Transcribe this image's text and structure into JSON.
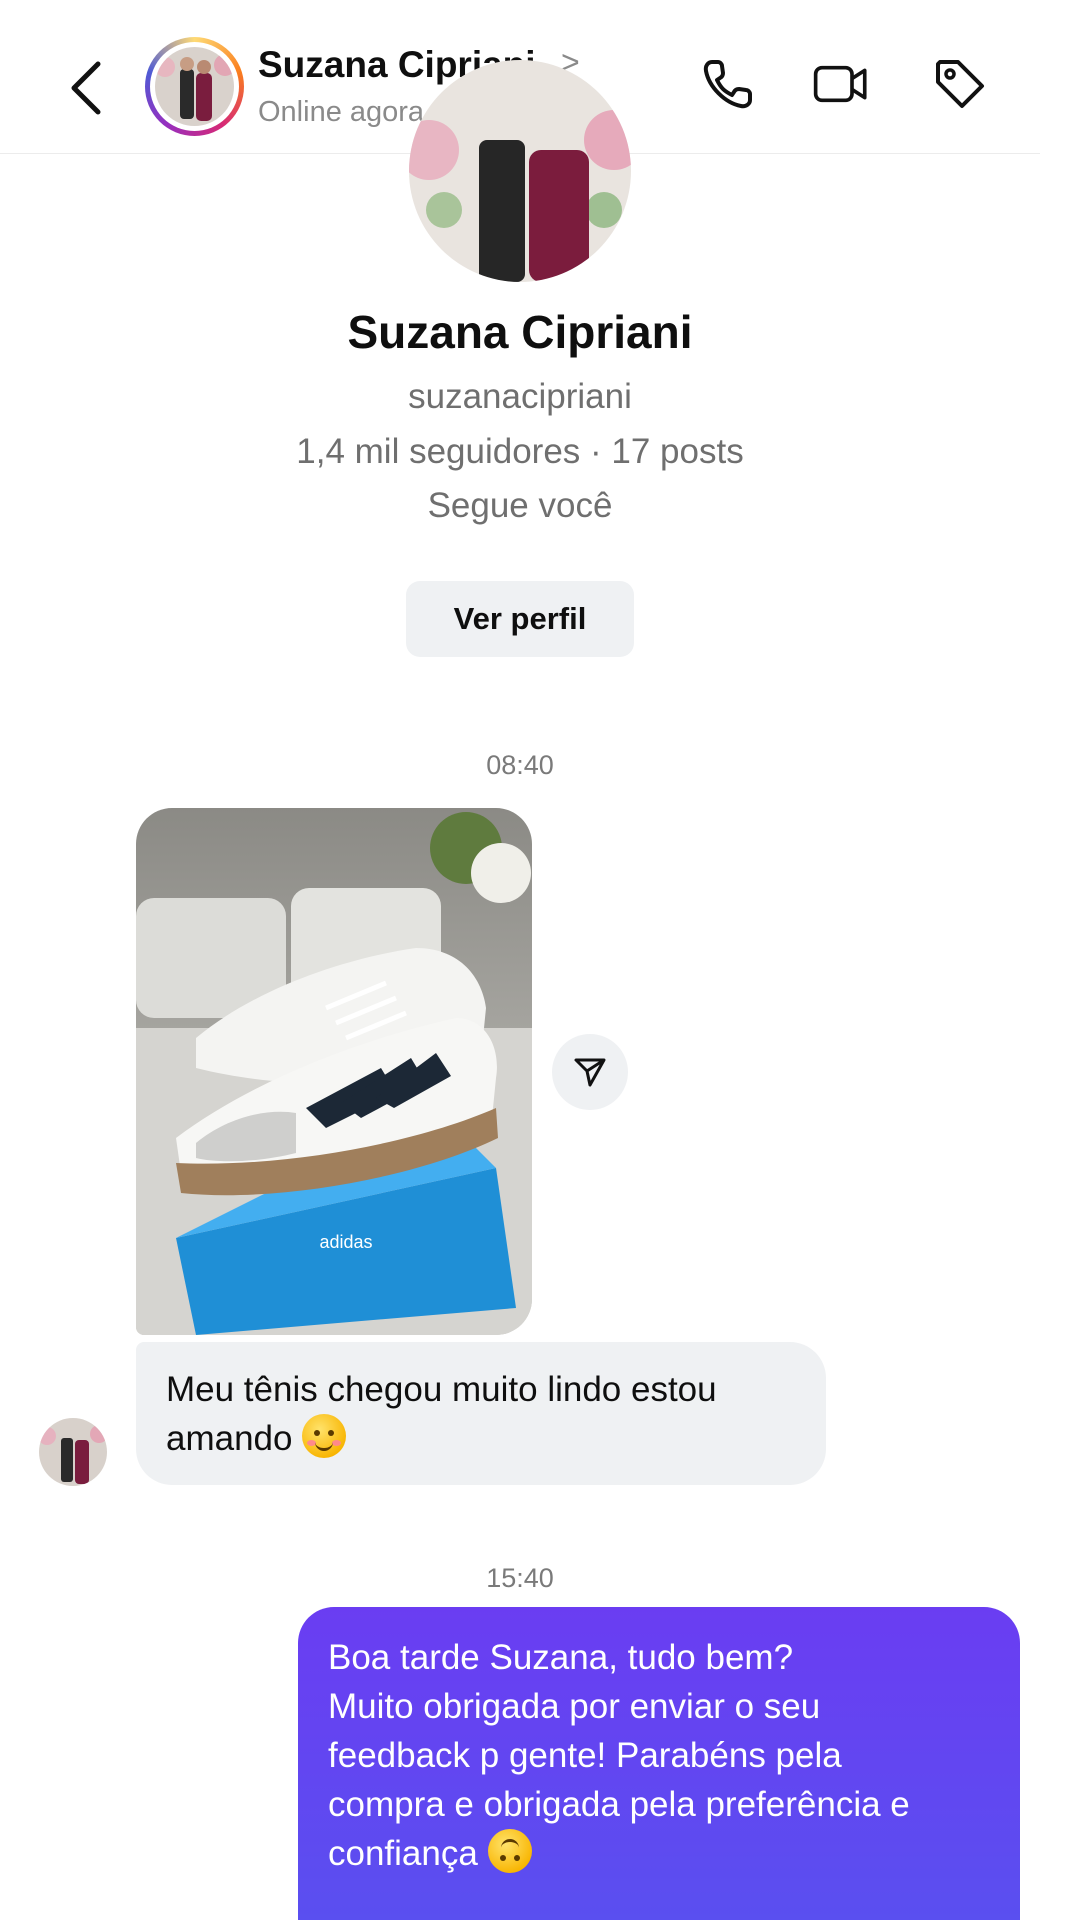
{
  "header": {
    "contact_name": "Suzana Cipriani",
    "chevron": ">",
    "status": "Online agora",
    "icons": [
      "back-chevron-icon",
      "phone-icon",
      "video-camera-icon",
      "tag-icon"
    ]
  },
  "profile": {
    "name": "Suzana Cipriani",
    "username": "suzanacipriani",
    "stats": "1,4 mil seguidores · 17 posts",
    "follows_you": "Segue você",
    "view_profile_label": "Ver perfil"
  },
  "messages": [
    {
      "timestamp": "08:40"
    },
    {
      "incoming_text": "Meu tênis chegou muito lindo estou amando",
      "emoji": "smiling-face-with-hearts"
    },
    {
      "timestamp": "15:40"
    },
    {
      "outgoing_lines": [
        "Boa tarde Suzana, tudo bem?",
        "Muito obrigada por enviar o seu",
        "feedback p gente! Parabéns pela",
        "compra e obrigada pela preferência e",
        "confiança"
      ],
      "emoji": "upside-down-face"
    }
  ],
  "colors": {
    "accent_bubble": "#5a4ff0",
    "incoming_bubble": "#eff1f3",
    "muted_text": "#8a8a8a"
  }
}
